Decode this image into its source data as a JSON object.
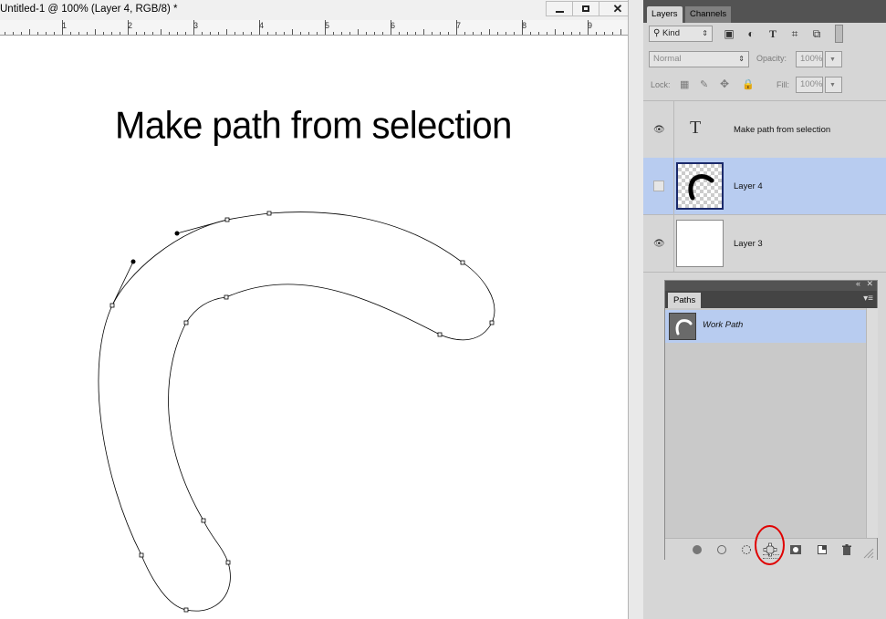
{
  "document": {
    "title": "Untitled-1 @ 100% (Layer 4, RGB/8) *",
    "ruler_numbers": [
      "1",
      "2",
      "3",
      "4",
      "5",
      "6",
      "7",
      "8",
      "9"
    ],
    "canvas_heading": "Make path from selection"
  },
  "window_controls": {
    "minimize": "minimize-icon",
    "maximize": "maximize-icon",
    "close": "✕"
  },
  "layers_panel": {
    "tabs": [
      "Layers",
      "Channels"
    ],
    "filter_kind": "Kind",
    "filter_icons": [
      "image-filter-icon",
      "adjustment-filter-icon",
      "type-filter-icon",
      "shape-filter-icon",
      "smart-object-filter-icon",
      "toggle-filter-icon"
    ],
    "blend_mode": "Normal",
    "opacity_label": "Opacity:",
    "opacity_value": "100%",
    "lock_label": "Lock:",
    "fill_label": "Fill:",
    "fill_value": "100%",
    "layers": [
      {
        "name": "Make path from selection",
        "type": "text",
        "visible": true,
        "selected": false,
        "thumb_glyph": "T"
      },
      {
        "name": "Layer 4",
        "type": "pixel",
        "visible": false,
        "selected": true
      },
      {
        "name": "Layer 3",
        "type": "pixel",
        "visible": true,
        "selected": false
      }
    ],
    "selected_color": "#b8ccf0"
  },
  "paths_panel": {
    "tab": "Paths",
    "paths": [
      {
        "name": "Work Path",
        "selected": true
      }
    ],
    "footer_buttons": [
      "fill-path-icon",
      "stroke-path-icon",
      "load-as-selection-icon",
      "make-work-path-icon",
      "add-mask-icon",
      "new-path-icon",
      "delete-path-icon"
    ],
    "highlight_color": "#e00000"
  }
}
